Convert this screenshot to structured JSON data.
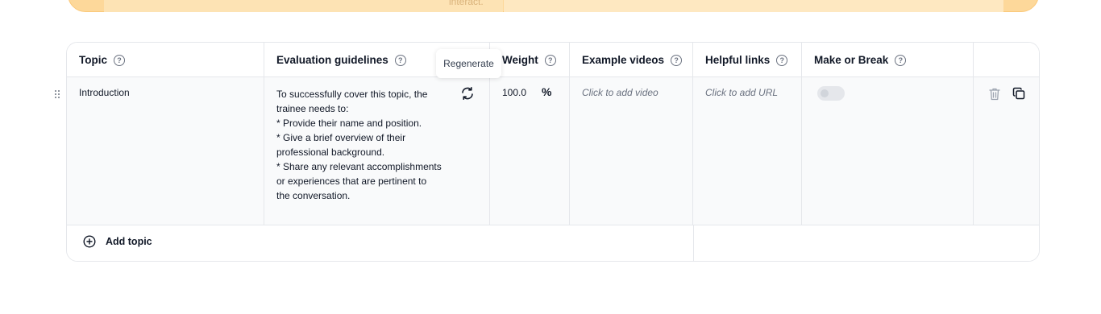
{
  "banner": {
    "ghost_text": "interact."
  },
  "headers": {
    "topic": "Topic",
    "guidelines": "Evaluation guidelines",
    "weight": "Weight",
    "videos": "Example videos",
    "links": "Helpful links",
    "make_break": "Make or Break",
    "help_glyph": "?"
  },
  "tooltip": {
    "regenerate": "Regenerate"
  },
  "row": {
    "topic": "Introduction",
    "guidelines": [
      "To successfully cover this topic, the",
      "trainee needs to:",
      "* Provide their name and position.",
      "* Give a brief overview of their",
      "professional background.",
      "* Share any relevant accomplishments",
      "or experiences that are pertinent to",
      "the conversation."
    ],
    "weight": "100.0",
    "weight_unit_icon": "%",
    "video_placeholder": "Click to add video",
    "url_placeholder": "Click to add URL",
    "make_or_break": false
  },
  "footer": {
    "add_topic": "Add topic"
  },
  "icons": {
    "regenerate": "refresh-cycle-icon",
    "trash": "trash-icon",
    "copy": "copy-icon",
    "drag": "drag-handle-icon",
    "add": "plus-circle-icon",
    "help": "question-circle-icon"
  }
}
